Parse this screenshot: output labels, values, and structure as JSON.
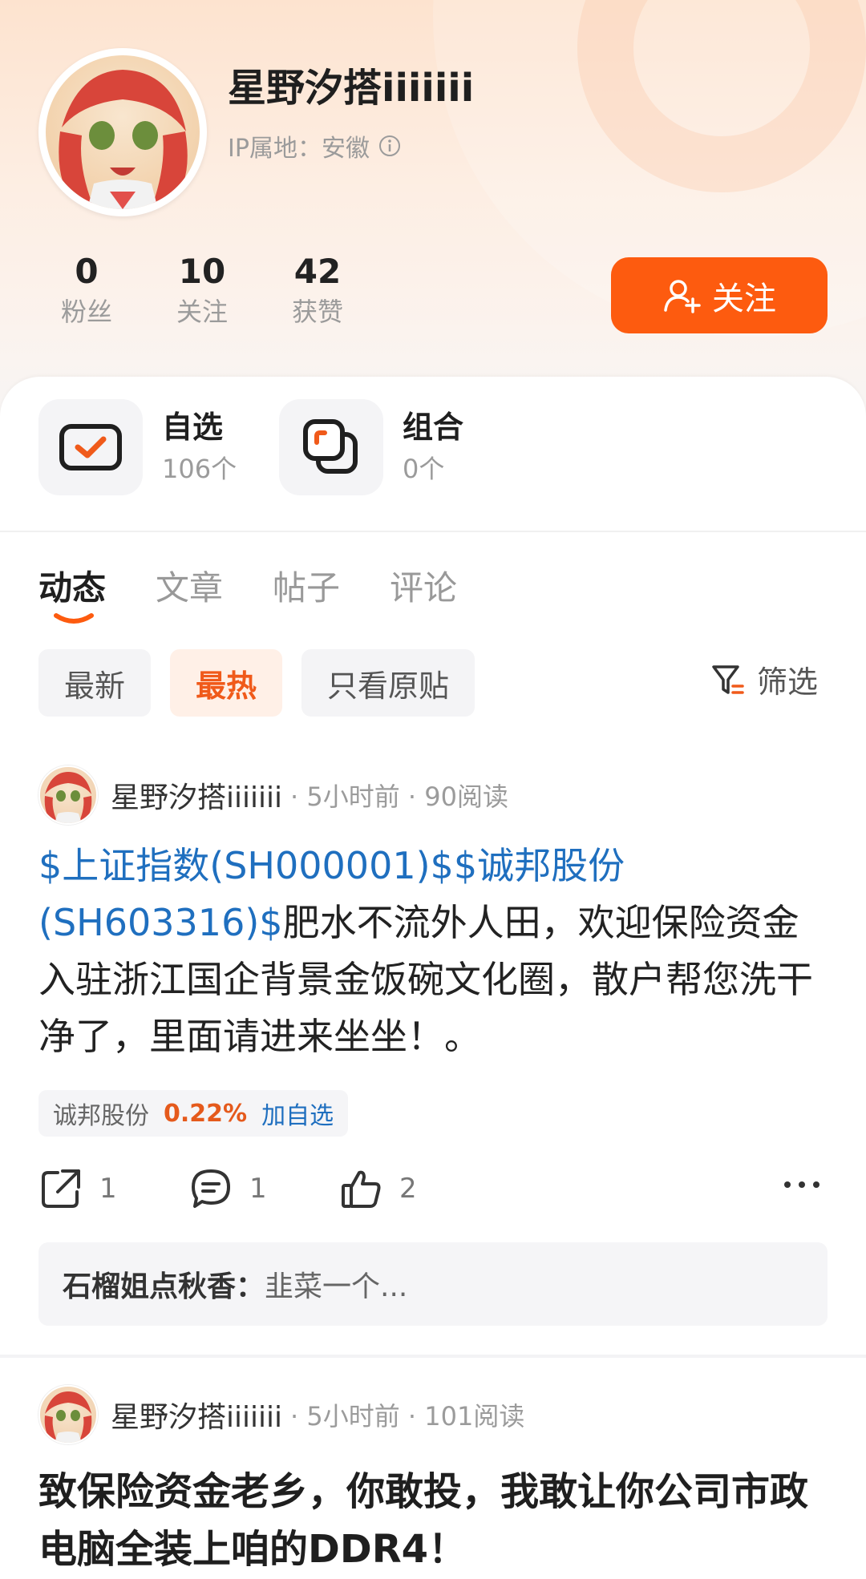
{
  "profile": {
    "username": "星野汐搭iiiiiii",
    "ip_location": "IP属地：安徽",
    "stats": [
      {
        "value": "0",
        "label": "粉丝"
      },
      {
        "value": "10",
        "label": "关注"
      },
      {
        "value": "42",
        "label": "获赞"
      }
    ],
    "follow_label": "关注"
  },
  "quick_cards": [
    {
      "title": "自选",
      "count": "106个",
      "icon": "checkbox-icon"
    },
    {
      "title": "组合",
      "count": "0个",
      "icon": "stack-icon"
    }
  ],
  "tabs": [
    "动态",
    "文章",
    "帖子",
    "评论"
  ],
  "filters": {
    "chips": [
      "最新",
      "最热",
      "只看原贴"
    ],
    "active": "最热",
    "filter_label": "筛选"
  },
  "posts": [
    {
      "author": "星野汐搭iiiiiii",
      "meta": "· 5小时前 · 90阅读",
      "stock_links": "$上证指数(SH000001)$$诚邦股份(SH603316)$",
      "body": "肥水不流外人田，欢迎保险资金入驻浙江国企背景金饭碗文化圈，散户帮您洗干净了，里面请进来坐坐！。",
      "tag": {
        "name": "诚邦股份",
        "change": "0.22%",
        "add": "加自选"
      },
      "actions": {
        "share": "1",
        "comment": "1",
        "like": "2"
      },
      "comment": {
        "user": "石榴姐点秋香：",
        "text": "韭菜一个..."
      }
    },
    {
      "author": "星野汐搭iiiiiii",
      "meta": "· 5小时前 · 101阅读",
      "title": "致保险资金老乡，你敢投，我敢让你公司市政电脑全装上咱的DDR4！"
    }
  ],
  "colors": {
    "accent": "#fd5b0f",
    "link": "#1f6fbf",
    "up": "#e55a1c"
  }
}
